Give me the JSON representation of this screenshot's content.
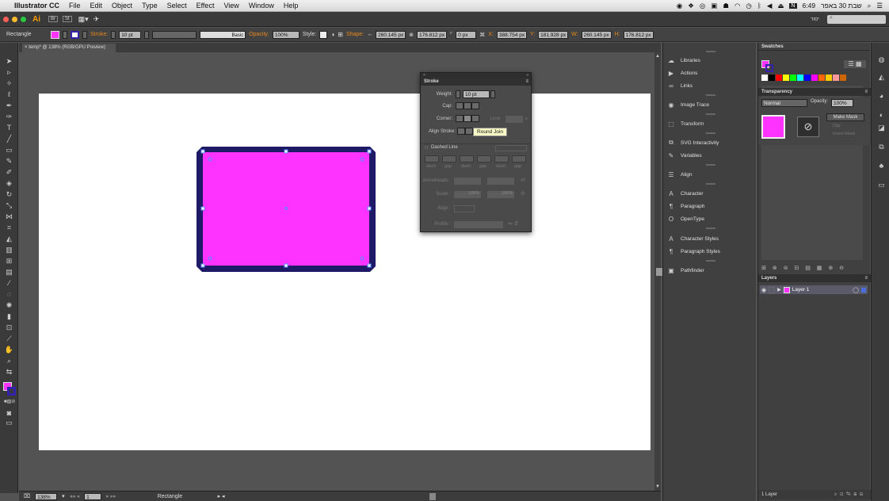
{
  "menubar": {
    "apple": "",
    "app_name": "Illustrator CC",
    "items": [
      "File",
      "Edit",
      "Object",
      "Type",
      "Select",
      "Effect",
      "View",
      "Window",
      "Help"
    ],
    "clock": "6:49",
    "date": "שבת 30 באפר"
  },
  "appbar": {
    "logo": "Ai",
    "icons": [
      "Br",
      "St"
    ],
    "workspace": "יסוד"
  },
  "controlbar": {
    "selection": "Rectangle",
    "stroke_label": "Stroke:",
    "stroke_weight": "10 pt",
    "brush_label": "Basic",
    "opacity_label": "Opacity:",
    "opacity_value": "100%",
    "style_label": "Style:",
    "shape_label": "Shape:",
    "shape_w": "260.145 px",
    "shape_h": "176.812 px",
    "corner": "0 px",
    "x_label": "X:",
    "x_value": "388.754 px",
    "y_label": "Y:",
    "y_value": "181.928 px",
    "w_label": "W:",
    "w_value": "260.145 px",
    "h_label": "H:",
    "h_value": "176.812 px"
  },
  "document": {
    "tab_title": "temp* @ 138% (RGB/GPU Preview)",
    "tab_close": "×"
  },
  "rectangle": {
    "fill": "#ff33ff",
    "stroke": "#1f1a66"
  },
  "stroke_panel": {
    "title": "Stroke",
    "weight_label": "Weight:",
    "weight_value": "10 pt",
    "cap_label": "Cap:",
    "corner_label": "Corner:",
    "limit_label": "Limit:",
    "limit_unit": "x",
    "align_label": "Align Stroke:",
    "dashed_label": "Dashed Line",
    "dash_labels": [
      "dash",
      "gap",
      "dash",
      "gap",
      "dash",
      "gap"
    ],
    "arrowheads_label": "Arrowheads:",
    "scale_label": "Scale:",
    "scale_value1": "100%",
    "scale_value2": "100%",
    "align2_label": "Align:",
    "profile_label": "Profile:"
  },
  "tooltip": "Round Join",
  "mid_panel": {
    "items": [
      {
        "icon": "☁",
        "label": "Libraries"
      },
      {
        "icon": "▶",
        "label": "Actions"
      },
      {
        "icon": "∞",
        "label": "Links"
      },
      {
        "icon": "◉",
        "label": "Image Trace"
      },
      {
        "icon": "⬚",
        "label": "Transform"
      },
      {
        "icon": "⧉",
        "label": "SVG Interactivity"
      },
      {
        "icon": "✎",
        "label": "Variables"
      },
      {
        "icon": "☰",
        "label": "Align"
      },
      {
        "icon": "A",
        "label": "Character"
      },
      {
        "icon": "¶",
        "label": "Paragraph"
      },
      {
        "icon": "O",
        "label": "OpenType"
      },
      {
        "icon": "A",
        "label": "Character Styles"
      },
      {
        "icon": "¶",
        "label": "Paragraph Styles"
      },
      {
        "icon": "▣",
        "label": "Pathfinder"
      }
    ]
  },
  "swatches": {
    "title": "Swatches",
    "colors": [
      "#ffffff",
      "#000000",
      "#ff0000",
      "#ffff00",
      "#00ff00",
      "#00ffff",
      "#0000ff",
      "#ff00ff",
      "#ff6600",
      "#ffcc00",
      "#ff9999",
      "#cc6600"
    ]
  },
  "transparency": {
    "title": "Transparency",
    "mode": "Normal",
    "opacity_label": "Opacity:",
    "opacity_value": "100%",
    "make_mask": "Make Mask",
    "clip": "Clip",
    "invert": "Invert Mask"
  },
  "layers": {
    "title": "Layers",
    "layer_name": "Layer 1",
    "footer": "1 Layer"
  },
  "status": {
    "zoom": "138%",
    "page": "1",
    "tool": "Rectangle"
  }
}
